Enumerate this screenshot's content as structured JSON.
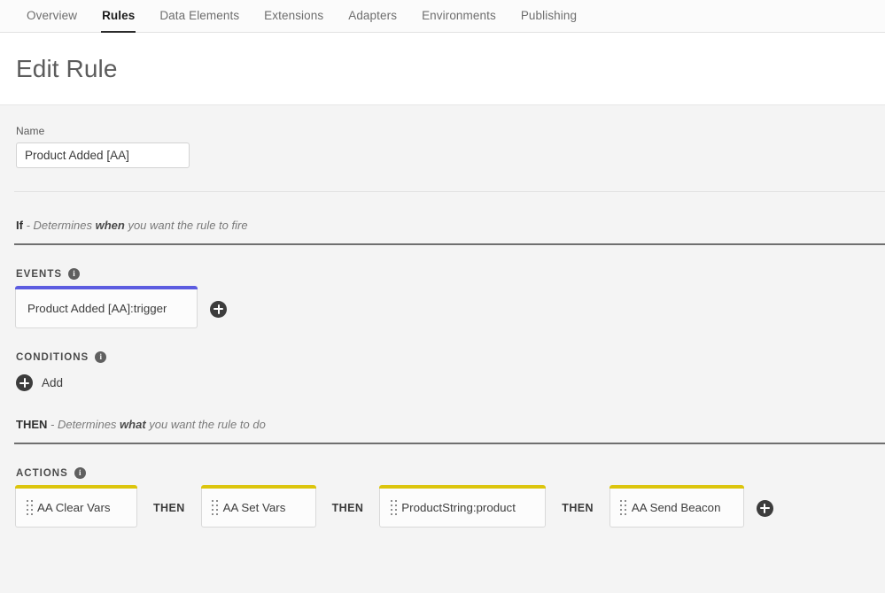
{
  "nav": {
    "tabs": [
      {
        "label": "Overview",
        "active": false
      },
      {
        "label": "Rules",
        "active": true
      },
      {
        "label": "Data Elements",
        "active": false
      },
      {
        "label": "Extensions",
        "active": false
      },
      {
        "label": "Adapters",
        "active": false
      },
      {
        "label": "Environments",
        "active": false
      },
      {
        "label": "Publishing",
        "active": false
      }
    ]
  },
  "header": {
    "title": "Edit Rule"
  },
  "name_field": {
    "label": "Name",
    "value": "Product Added [AA]",
    "placeholder": "Name"
  },
  "if_section": {
    "keyword": "If",
    "dash": " - ",
    "text_a": "Determines ",
    "emphasis": "when",
    "text_b": " you want the rule to fire"
  },
  "events": {
    "label": "EVENTS",
    "info_icon": "info-icon",
    "accent_color": "#5c5ce0",
    "items": [
      {
        "label": "Product Added [AA]:trigger"
      }
    ],
    "add_icon": "plus-circle-icon"
  },
  "conditions": {
    "label": "CONDITIONS",
    "info_icon": "info-icon",
    "add_icon": "plus-circle-icon",
    "add_label": "Add"
  },
  "then_section": {
    "keyword": "THEN",
    "dash": " - ",
    "text_a": "Determines ",
    "emphasis": "what",
    "text_b": " you want the rule to do"
  },
  "actions": {
    "label": "ACTIONS",
    "info_icon": "info-icon",
    "accent_color": "#dcc50d",
    "separator_label": "THEN",
    "items": [
      {
        "label": "AA Clear Vars",
        "drag_icon": "drag-handle-icon"
      },
      {
        "label": "AA Set Vars",
        "drag_icon": "drag-handle-icon"
      },
      {
        "label": "ProductString:product",
        "drag_icon": "drag-handle-icon"
      },
      {
        "label": "AA Send Beacon",
        "drag_icon": "drag-handle-icon"
      }
    ],
    "add_icon": "plus-circle-icon"
  }
}
